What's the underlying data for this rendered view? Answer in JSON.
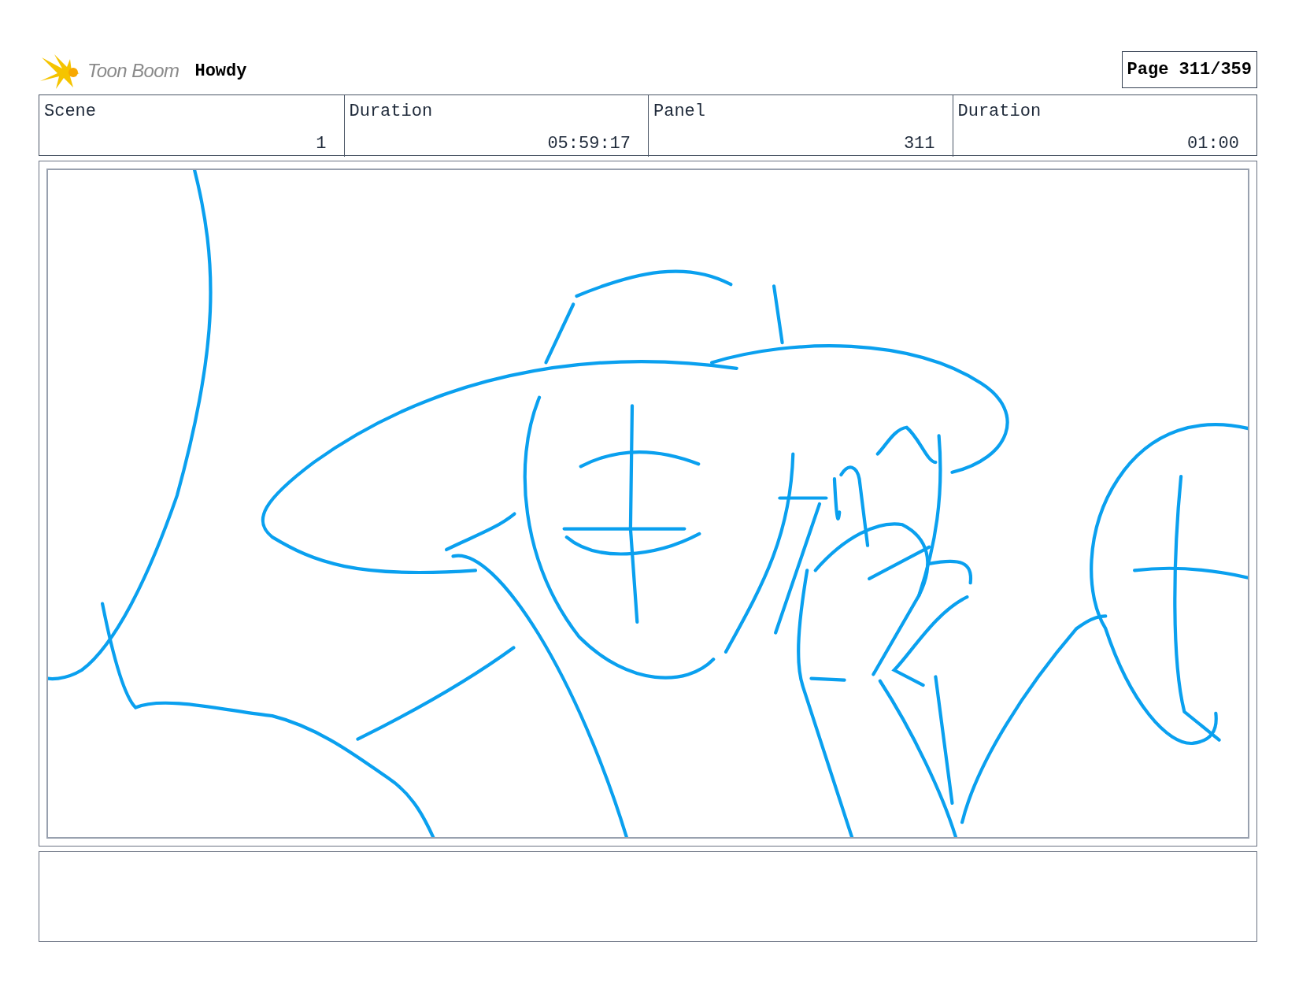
{
  "header": {
    "logo_text": "Toon Boom",
    "project_title": "Howdy",
    "page": "Page 311/359"
  },
  "fields": [
    {
      "label": "Scene",
      "value": "1"
    },
    {
      "label": "Duration",
      "value": "05:59:17"
    },
    {
      "label": "Panel",
      "value": "311"
    },
    {
      "label": "Duration",
      "value": "01:00"
    }
  ]
}
